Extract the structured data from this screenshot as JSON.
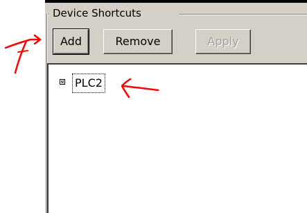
{
  "group": {
    "title": "Device Shortcuts"
  },
  "toolbar": {
    "add_label": "Add",
    "remove_label": "Remove",
    "apply_label": "Apply"
  },
  "tree": {
    "items": [
      {
        "label": "PLC2",
        "icon": "node-icon"
      }
    ]
  },
  "annotations": {
    "color": "#ff0000",
    "marks": [
      "arrow-to-add-button",
      "arrow-to-plc2-node"
    ]
  }
}
